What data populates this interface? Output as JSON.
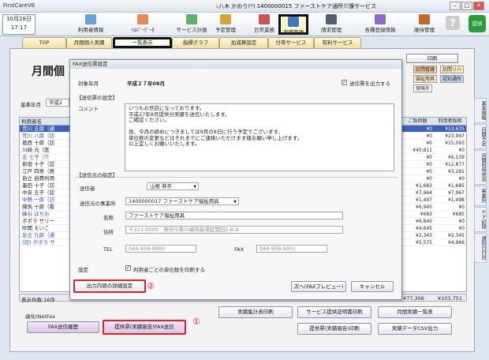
{
  "window": {
    "app_name": "FirstCareV6",
    "title": "♭八木 かおり(*) 1400000015 ファーストケア通所介護サービス",
    "min": "–",
    "max": "□",
    "close": "✕"
  },
  "date": {
    "line1": "10月28日",
    "line2": "17:17",
    "arrows": "‹ ›"
  },
  "toolbar": [
    {
      "label": "利用者情報",
      "color": "#6aa0d8"
    },
    {
      "label": "ﾍﾙﾊﾟｰﾃﾞｰﾀ",
      "color": "#e48b5a"
    },
    {
      "label": "サービス計画",
      "color": "#5fb16a"
    },
    {
      "label": "予定管理",
      "color": "#d9a23a"
    },
    {
      "label": "日常業務",
      "color": "#c95454"
    },
    {
      "label": "実績管理",
      "color": "#3f78c0"
    },
    {
      "label": "請求管理",
      "color": "#555f72"
    },
    {
      "label": "各種登録情報",
      "color": "#8a6cc4"
    },
    {
      "label": "維持管理",
      "color": "#c26a2a"
    }
  ],
  "help_icon": "?",
  "green_button": "提供",
  "tabs": [
    "TOP",
    "月間個人実績",
    "一覧表示",
    "指標グラフ",
    "加減算設定",
    "付帯サービス",
    "有料サービス"
  ],
  "page_title": "月間個",
  "print_button": "印刷",
  "tags": [
    "訪問看護",
    "訪問リハ",
    "福祉用具",
    "認知通所",
    "保険外"
  ],
  "base_month_label": "基準年月",
  "base_month_value": "平成2",
  "left_grid": {
    "header": "利用者名",
    "rows": [
      "荒川 五郎（通",
      "荒川 八郎（訪",
      "葛西 十郎（訪",
      "川崎 元（医",
      "北 七子（介",
      "新宿 十子（認",
      "江戸 四男（居",
      "自立 自費利用",
      "墨田 十子（訪",
      "中央 五子（認",
      "中野 一郎（訪",
      "練馬 十郎（看",
      "蜂谷 はちお",
      "ポポラ サリー",
      "吹聞 えいこ",
      "足立 九郎（通",
      "(旧) ポポラ サ"
    ]
  },
  "right_grid": {
    "headers": [
      "ご負担額",
      "利用者負担"
    ],
    "rows": [
      [
        "¥0",
        "¥13,635"
      ],
      [
        "¥0",
        "¥23,997"
      ],
      [
        "¥0",
        "¥15,093"
      ],
      [
        "¥40,811",
        "¥0"
      ],
      [
        "¥0",
        "¥6,139"
      ],
      [
        "¥0",
        "¥12,877"
      ],
      [
        "¥0",
        "¥3,291"
      ],
      [
        "¥0",
        "¥0"
      ],
      [
        "¥1,683",
        "¥1,685"
      ],
      [
        "¥7,964",
        "¥7,967"
      ],
      [
        "¥1,497",
        "¥1,498"
      ],
      [
        "¥6,940",
        "¥0"
      ],
      [
        "¥683",
        "¥685"
      ],
      [
        "¥6,840",
        "¥0"
      ],
      [
        "¥4,645",
        "¥0"
      ],
      [
        "¥2,343",
        "¥2,345"
      ],
      [
        "¥5,575",
        "¥4,966"
      ]
    ]
  },
  "totals": {
    "count_label": "表示件数:16件",
    "total1": "¥77,306",
    "total2": "¥103,751"
  },
  "netfax_label": "歳化(NetFax",
  "bottom_buttons": {
    "fax_history": "FAX送信履歴",
    "fax_send": "提供票(実績報告)FAX送信",
    "plan_print": "実績集計表印刷",
    "service_cert": "サービス提供証明書印刷",
    "monthly_list": "月間実績一覧表",
    "report_print": "提供票(実績報告)印刷",
    "csv_out": "実績データCSV出力"
  },
  "annotations": {
    "one": "①",
    "two": "②"
  },
  "side_tabs": [
    "基本情報",
    "月間予定",
    "月間利用状況",
    "事業所",
    "ケア記録",
    "通所日付別"
  ],
  "dialog": {
    "title": "FAX送信票設定",
    "target_label": "対象年月",
    "target_value": "平成２７年08月",
    "output_check_label": "送信票を出力する",
    "section1": "【送信票の設定】",
    "comment_label": "コメント",
    "comment_text": "いつもお世話になっております。\n平成27年8月提供分実績を送信いたします。\nご確認ください。\n\n尚、今月の締めにつきましては9月の8日に行う予定でございます。\n単位数の変更などはそれまでにご連絡いただけます様お願い申し上げます。\n以上宜しくお願いいたします。",
    "section2": "【送信元の指定】",
    "sender_label": "送信者",
    "sender_value": "山根 恭平",
    "office_label": "送信元の事業所",
    "office_value": "1400000017 ファーストケア福祉用具",
    "name_label": "名称",
    "name_value": "ファーストケア福祉用具",
    "address_label": "住所",
    "address_value": "〒213-0000　神奈川県川崎市高津区関田5-8-9",
    "tel_label": "TEL",
    "tel_value": "044-959-0000",
    "fax_label": "FAX",
    "fax_value": "044-959-0001",
    "setting_label": "設定",
    "unit_check_label": "利用者ごとの単位数を印刷する",
    "detail_button": "出力内容の詳細設定",
    "next_button": "次へ(FAXプレビュー)",
    "cancel_button": "キャンセル"
  }
}
